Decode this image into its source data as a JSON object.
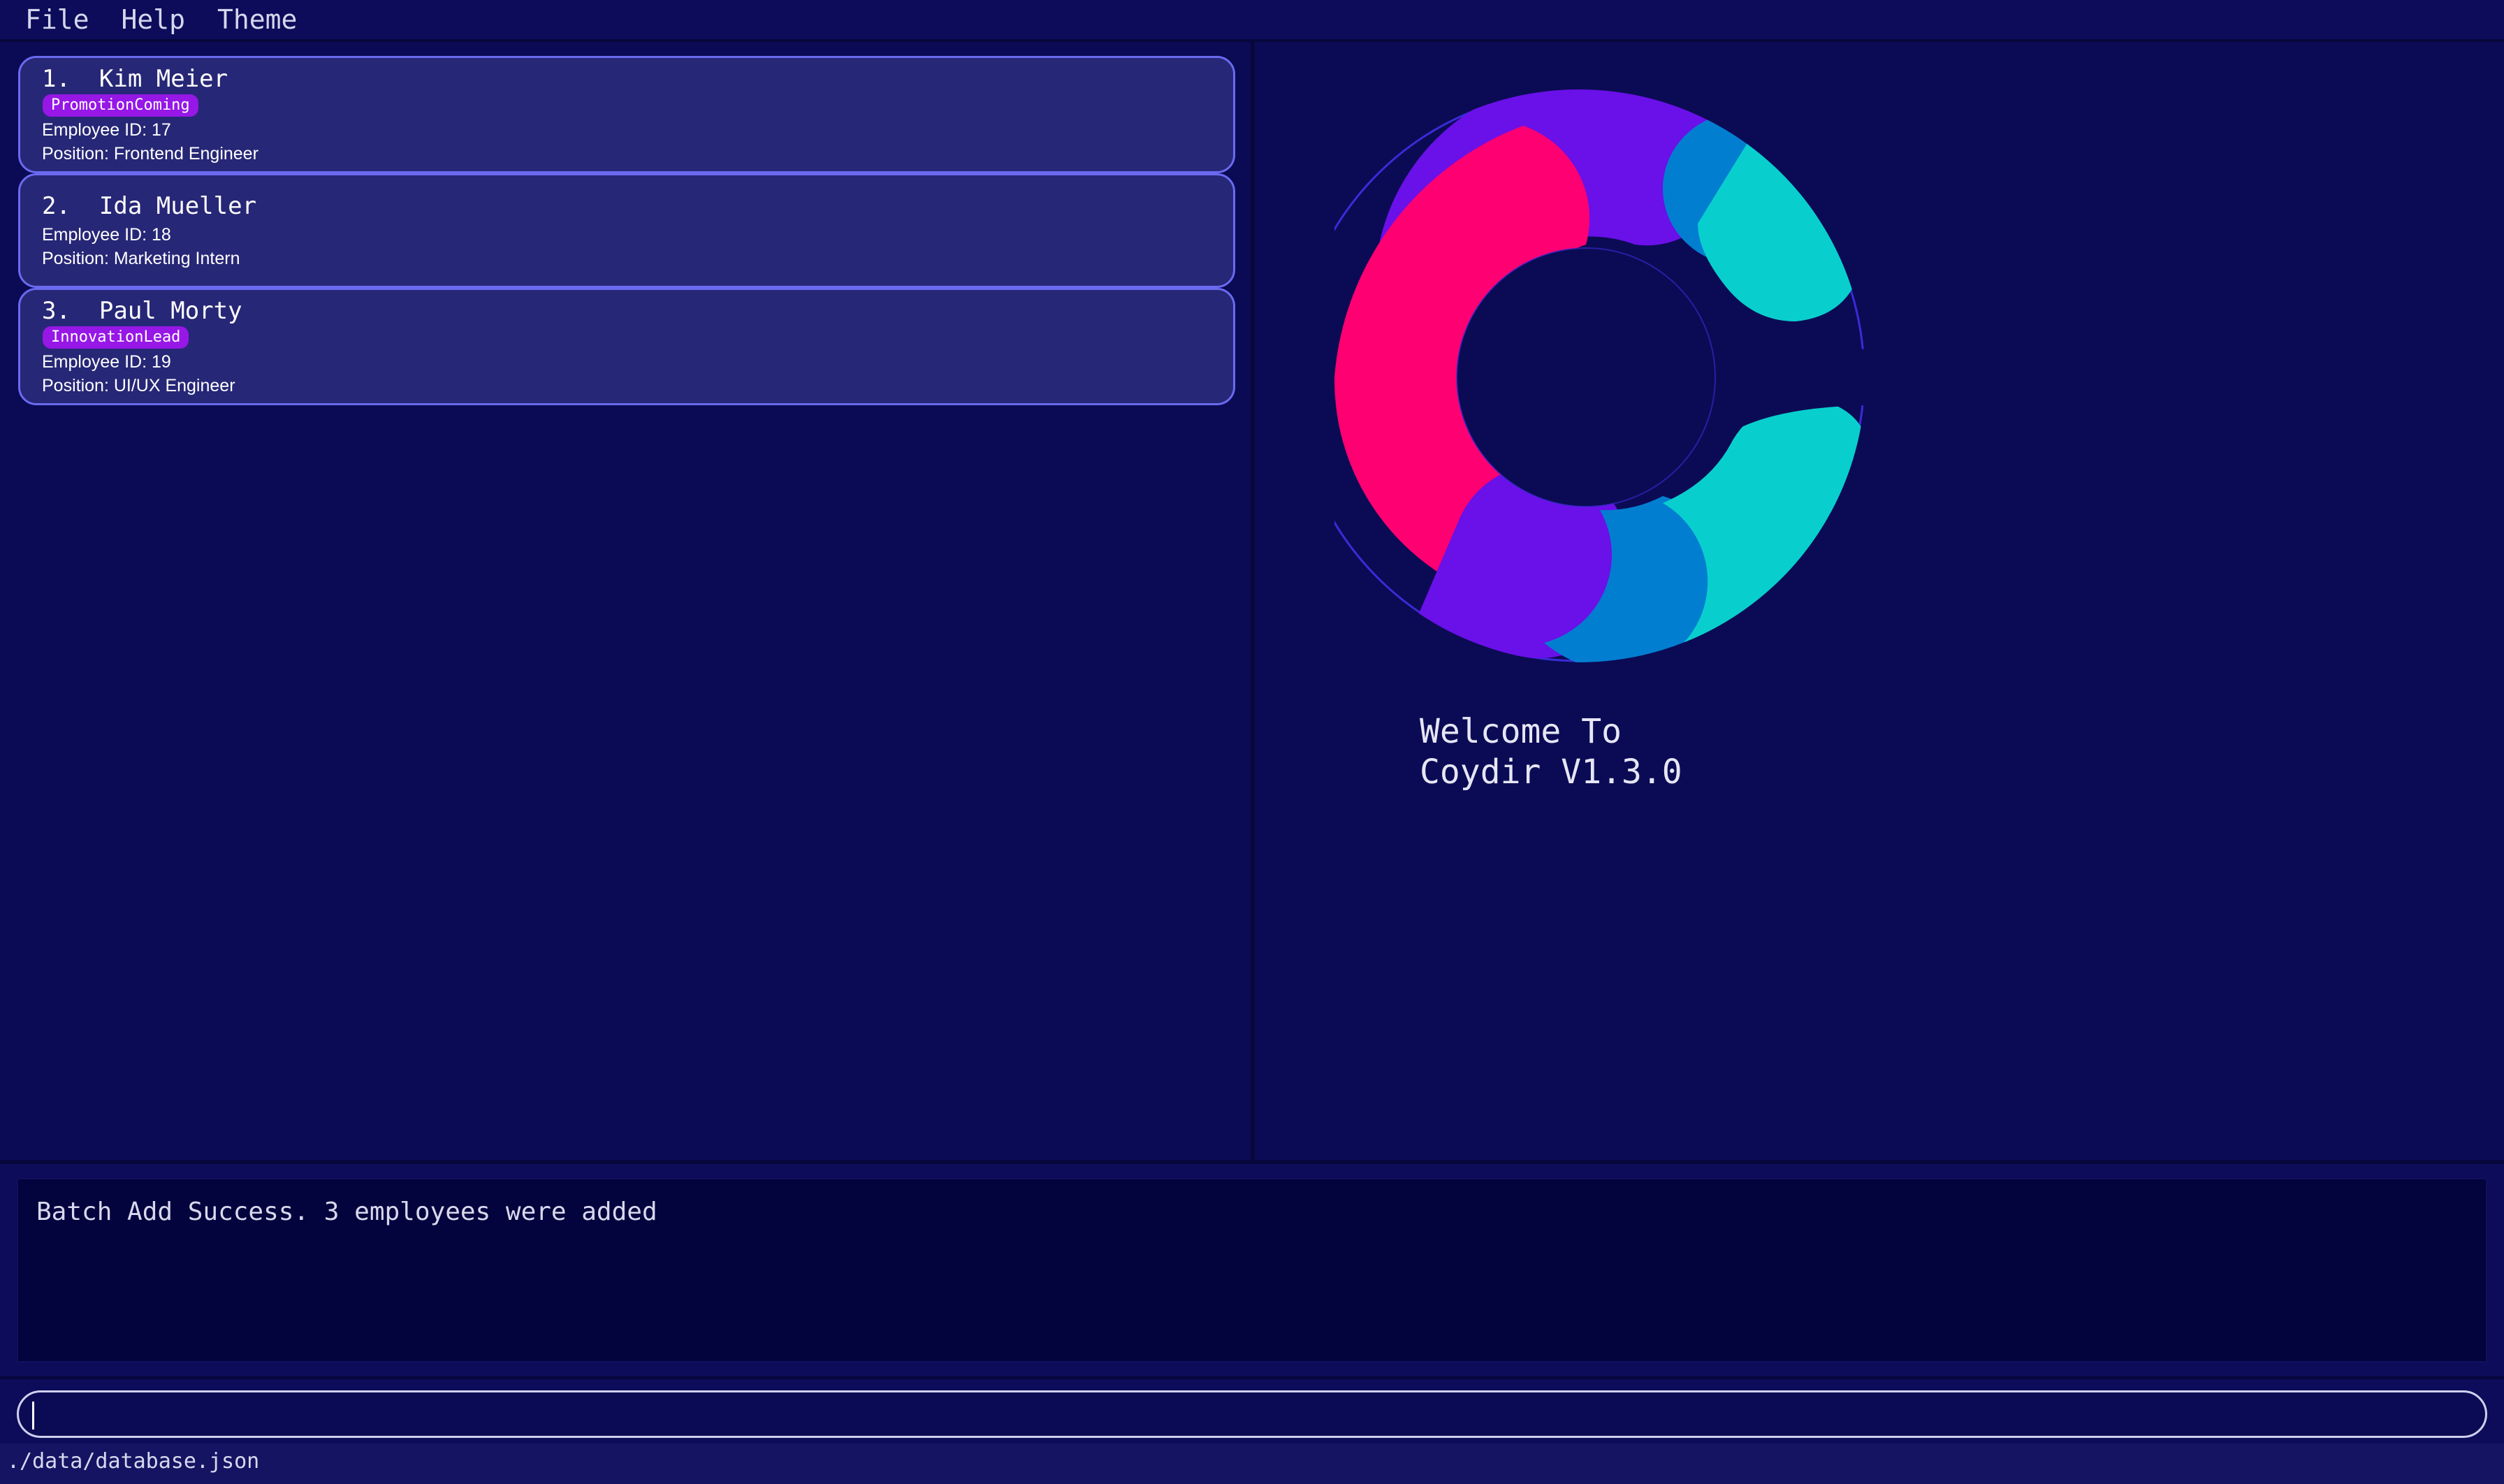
{
  "menu": {
    "items": [
      "File",
      "Help",
      "Theme"
    ]
  },
  "employees": [
    {
      "index_name": "1.  Kim Meier",
      "tag": "PromotionComing",
      "employee_id": "Employee ID: 17",
      "position": "Position: Frontend Engineer"
    },
    {
      "index_name": "2.  Ida Mueller",
      "tag": "",
      "employee_id": "Employee ID: 18",
      "position": "Position: Marketing Intern"
    },
    {
      "index_name": "3.  Paul Morty",
      "tag": "InnovationLead",
      "employee_id": "Employee ID: 19",
      "position": "Position: UI/UX Engineer"
    }
  ],
  "welcome": {
    "line1": "Welcome To",
    "line2": "Coydir V1.3.0"
  },
  "result": {
    "message": "Batch Add Success. 3 employees were added"
  },
  "command": {
    "value": ""
  },
  "status": {
    "file_path": "./data/database.json"
  },
  "colors": {
    "background": "#0b0b55",
    "card": "#272777",
    "card_border": "#6a6af0",
    "tag": "#9617e6",
    "logo_pink": "#ff0072",
    "logo_purple": "#6a10e8",
    "logo_blue": "#027ed1",
    "logo_teal": "#08cfce"
  },
  "icons": {
    "logo": "coydir-c-logo"
  }
}
